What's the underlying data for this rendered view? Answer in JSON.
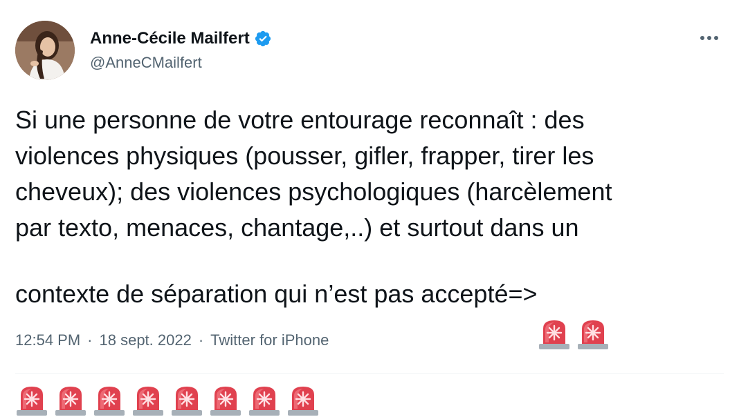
{
  "tweet": {
    "author": {
      "display_name": "Anne-Cécile Mailfert",
      "handle": "@AnneCMailfert",
      "verified": true,
      "avatar_icon": "profile-photo"
    },
    "more_icon": "more-horizontal-icon",
    "text_lines": [
      "Si une personne de votre entourage reconnaît : des",
      "violences physiques (pousser, gifler, frapper, tirer les",
      "cheveux); des violences psychologiques (harcèlement",
      "par texto, menaces, chantage,..) et surtout dans un",
      "contexte de séparation qui n’est pas accepté=>"
    ],
    "siren_emoji_count": 10,
    "siren_emoji": "🚨",
    "time": "12:54 PM",
    "date": "18 sept. 2022",
    "source": "Twitter for iPhone",
    "separator": "·",
    "colors": {
      "text": "#0f1419",
      "secondary": "#536471",
      "verified_blue": "#1d9bf0",
      "siren_red": "#e0414f"
    }
  }
}
